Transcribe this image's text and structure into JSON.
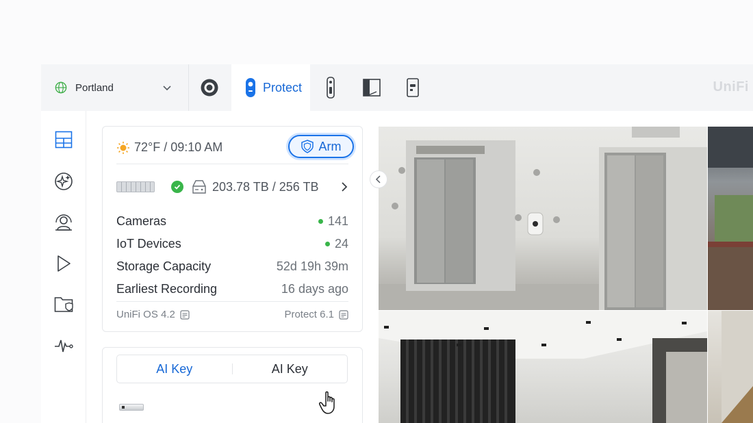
{
  "topbar": {
    "site": "Portland",
    "active_tab": "Protect",
    "brand": "UniFi",
    "tabs": [
      {
        "icon": "network-icon"
      },
      {
        "icon": "protect-camera-icon",
        "label": "Protect"
      },
      {
        "icon": "doorbell-icon"
      },
      {
        "icon": "access-icon"
      },
      {
        "icon": "intercom-icon"
      }
    ]
  },
  "sidebar": {
    "items": [
      "dashboard-icon",
      "ai-sparkle-icon",
      "detections-icon",
      "playback-icon",
      "files-icon",
      "activity-icon"
    ]
  },
  "status": {
    "weather": "72°F / 09:10 AM",
    "arm_label": "Arm",
    "storage": "203.78 TB / 256 TB",
    "stats": [
      {
        "label": "Cameras",
        "value": "141"
      },
      {
        "label": "IoT Devices",
        "value": "24"
      },
      {
        "label": "Storage Capacity",
        "value": "52d 19h 39m"
      },
      {
        "label": "Earliest Recording",
        "value": "16 days ago"
      }
    ],
    "os_version": "UniFi OS 4.2",
    "app_version": "Protect 6.1"
  },
  "ai_key": {
    "options": [
      "AI Key",
      "AI Key"
    ]
  },
  "colors": {
    "accent": "#1768d6",
    "online": "#39b54a"
  }
}
